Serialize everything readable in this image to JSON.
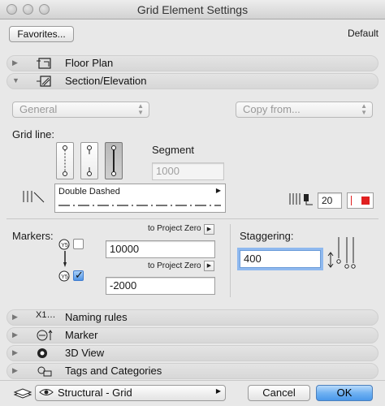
{
  "window": {
    "title": "Grid Element Settings"
  },
  "top": {
    "favorites_label": "Favorites...",
    "default_label": "Default"
  },
  "panels": [
    {
      "label": "Floor Plan",
      "icon": "floor-plan-icon",
      "expanded": false
    },
    {
      "label": "Section/Elevation",
      "icon": "section-elevation-icon",
      "expanded": true
    }
  ],
  "section": {
    "general_popup": "General",
    "copy_from_popup": "Copy from...",
    "grid_line_label": "Grid line:",
    "segment_label": "Segment",
    "segment_value": "1000",
    "line_type_name": "Double Dashed",
    "pen_value": "20",
    "pen_color": "#e02020",
    "markers_label": "Markers:",
    "to_project_zero_1": "to Project Zero",
    "marker_value_1": "10000",
    "to_project_zero_2": "to Project Zero",
    "marker_value_2": "-2000",
    "marker_top_checked": false,
    "marker_bottom_checked": true,
    "staggering_label": "Staggering:",
    "staggering_value": "400"
  },
  "bottom_panels": [
    {
      "label": "Naming rules",
      "icon": "naming-rules-icon"
    },
    {
      "label": "Marker",
      "icon": "marker-icon"
    },
    {
      "label": "3D View",
      "icon": "3d-view-icon"
    },
    {
      "label": "Tags and Categories",
      "icon": "tags-categories-icon"
    }
  ],
  "footer": {
    "layer_popup": "Structural - Grid",
    "cancel_label": "Cancel",
    "ok_label": "OK"
  },
  "colors": {
    "accent": "#4a98ea",
    "pen_color": "#e02020"
  }
}
